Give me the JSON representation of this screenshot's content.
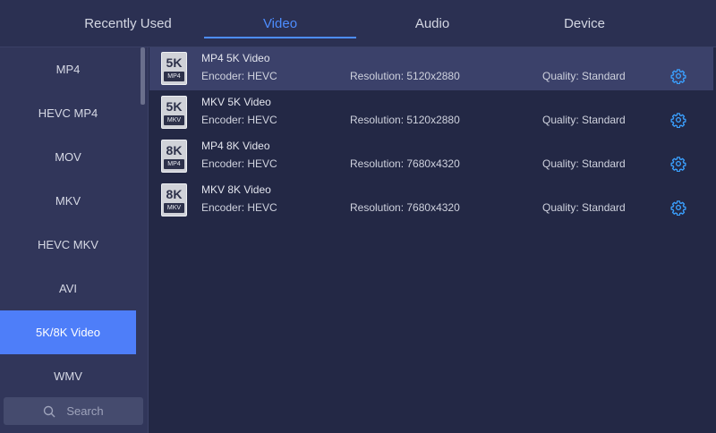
{
  "tabs": [
    {
      "label": "Recently Used",
      "active": false
    },
    {
      "label": "Video",
      "active": true
    },
    {
      "label": "Audio",
      "active": false
    },
    {
      "label": "Device",
      "active": false
    }
  ],
  "sidebar": {
    "items": [
      {
        "label": "MP4"
      },
      {
        "label": "HEVC MP4"
      },
      {
        "label": "MOV"
      },
      {
        "label": "MKV"
      },
      {
        "label": "HEVC MKV"
      },
      {
        "label": "AVI"
      },
      {
        "label": "5K/8K Video",
        "active": true
      },
      {
        "label": "WMV"
      }
    ],
    "search_placeholder": "Search"
  },
  "presets": [
    {
      "badge_res": "5K",
      "badge_fmt": "MP4",
      "title": "MP4 5K Video",
      "encoder": "Encoder: HEVC",
      "resolution": "Resolution: 5120x2880",
      "quality": "Quality: Standard",
      "selected": true
    },
    {
      "badge_res": "5K",
      "badge_fmt": "MKV",
      "title": "MKV 5K Video",
      "encoder": "Encoder: HEVC",
      "resolution": "Resolution: 5120x2880",
      "quality": "Quality: Standard"
    },
    {
      "badge_res": "8K",
      "badge_fmt": "MP4",
      "title": "MP4 8K Video",
      "encoder": "Encoder: HEVC",
      "resolution": "Resolution: 7680x4320",
      "quality": "Quality: Standard"
    },
    {
      "badge_res": "8K",
      "badge_fmt": "MKV",
      "title": "MKV 8K Video",
      "encoder": "Encoder: HEVC",
      "resolution": "Resolution: 7680x4320",
      "quality": "Quality: Standard"
    }
  ],
  "colors": {
    "accent": "#4d8dff",
    "sidebar_active": "#4e7ef9",
    "gear": "#3aa0ff"
  },
  "icons": {
    "settings": "gear-icon",
    "search": "search-icon"
  }
}
